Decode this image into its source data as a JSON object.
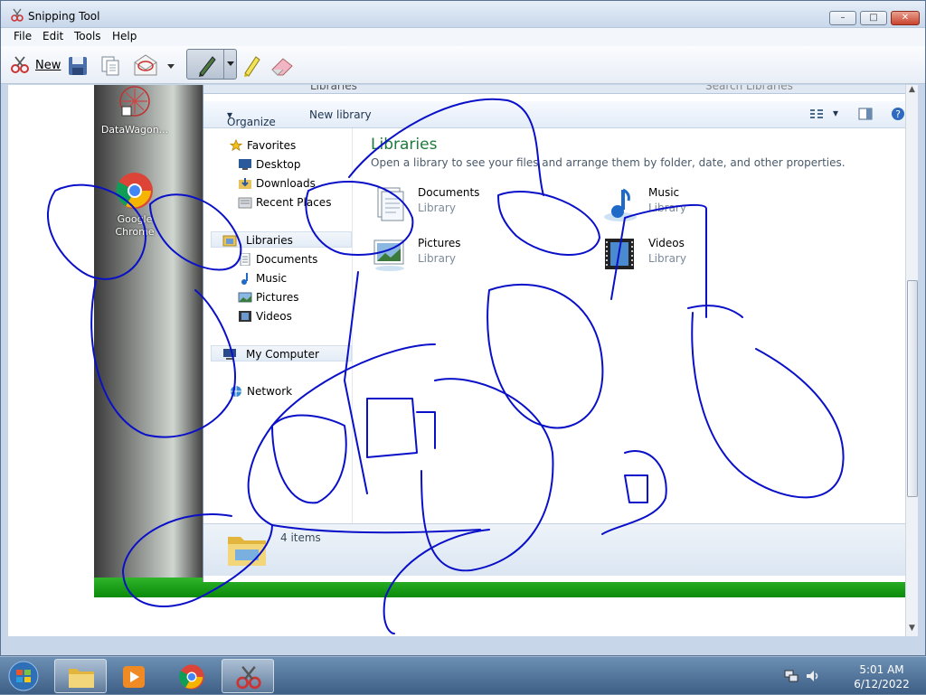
{
  "window": {
    "title": "Snipping Tool",
    "buttons": {
      "minimize": "–",
      "maximize": "□",
      "close": "✕"
    }
  },
  "menu": [
    "File",
    "Edit",
    "Tools",
    "Help"
  ],
  "toolbar": {
    "new_label": "New",
    "icons": [
      "scissors-icon",
      "save-icon",
      "copy-icon",
      "send-snip-icon",
      "dropdown-arrow-icon",
      "pen-icon",
      "pen-dropdown-icon",
      "highlighter-icon",
      "eraser-icon"
    ]
  },
  "desktop": {
    "icons": [
      {
        "label": "DataWagon..."
      },
      {
        "label": "Google Chrome"
      }
    ]
  },
  "explorer": {
    "address": "Libraries",
    "search_placeholder": "Search Libraries",
    "command_bar": {
      "organize": "Organize",
      "new_library": "New library"
    },
    "nav": {
      "favorites": "Favorites",
      "favorite_items": [
        "Desktop",
        "Downloads",
        "Recent Places"
      ],
      "libraries": "Libraries",
      "library_items": [
        "Documents",
        "Music",
        "Pictures",
        "Videos"
      ],
      "computer": "My Computer",
      "network": "Network"
    },
    "content": {
      "title": "Libraries",
      "description": "Open a library to see your files and arrange them by folder, date, and other properties.",
      "libraries": [
        {
          "name": "Documents",
          "type": "Library"
        },
        {
          "name": "Music",
          "type": "Library"
        },
        {
          "name": "Pictures",
          "type": "Library"
        },
        {
          "name": "Videos",
          "type": "Library"
        }
      ]
    },
    "details": {
      "count": "4 items"
    }
  },
  "ink_color": "#0a10c8",
  "taskbar": {
    "items": [
      "windows-start-icon",
      "explorer-icon",
      "media-player-icon",
      "chrome-icon",
      "snipping-tool-icon"
    ],
    "clock": {
      "time": "5:01 AM",
      "date": "6/12/2022"
    }
  }
}
